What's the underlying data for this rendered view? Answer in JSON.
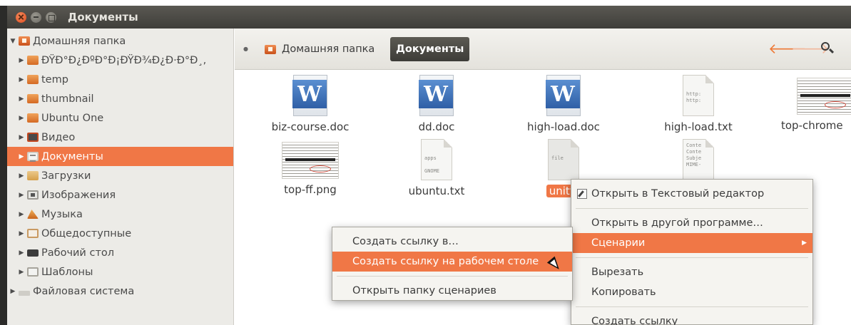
{
  "window": {
    "title": "Документы"
  },
  "sidebar": {
    "items": [
      {
        "label": "Домашняя папка",
        "icon": "home-folder-icon",
        "level": 0,
        "expanded": true
      },
      {
        "label": "ÐŸÐ°Ð¿ÐºÐ°Ð¡ÐŸÐ¾Ð¿Ð·Ð°Ð¸,",
        "icon": "folder-icon",
        "level": 1
      },
      {
        "label": "temp",
        "icon": "folder-icon",
        "level": 1
      },
      {
        "label": "thumbnail",
        "icon": "folder-icon",
        "level": 1
      },
      {
        "label": "Ubuntu One",
        "icon": "folder-icon",
        "level": 1
      },
      {
        "label": "Видео",
        "icon": "video-folder-icon",
        "level": 1
      },
      {
        "label": "Документы",
        "icon": "documents-folder-icon",
        "level": 1,
        "selected": true
      },
      {
        "label": "Загрузки",
        "icon": "downloads-folder-icon",
        "level": 1
      },
      {
        "label": "Изображения",
        "icon": "pictures-folder-icon",
        "level": 1
      },
      {
        "label": "Музыка",
        "icon": "music-folder-icon",
        "level": 1
      },
      {
        "label": "Общедоступные",
        "icon": "public-folder-icon",
        "level": 1
      },
      {
        "label": "Рабочий стол",
        "icon": "desktop-folder-icon",
        "level": 1
      },
      {
        "label": "Шаблоны",
        "icon": "templates-folder-icon",
        "level": 1
      },
      {
        "label": "Файловая система",
        "icon": "filesystem-icon",
        "level": 0
      }
    ]
  },
  "pathbar": {
    "home": "Домашняя папка",
    "current": "Документы"
  },
  "files": [
    {
      "name": "biz-course.doc",
      "type": "doc"
    },
    {
      "name": "dd.doc",
      "type": "doc"
    },
    {
      "name": "high-load.doc",
      "type": "doc"
    },
    {
      "name": "high-load.txt",
      "type": "txt",
      "preview": "http:\nhttp:"
    },
    {
      "name": "top-chrome",
      "type": "img"
    },
    {
      "name": "top-ff.png",
      "type": "img"
    },
    {
      "name": "ubuntu.txt",
      "type": "txt",
      "preview": "apps\n\nGNOME"
    },
    {
      "name": "unity.",
      "type": "txt",
      "preview": "file",
      "selected": true
    },
    {
      "name": "",
      "type": "txt",
      "preview": "Conte\nConte\nSubje\nMIME-"
    }
  ],
  "context_menu": {
    "items": [
      "Открыть в Текстовый редактор",
      "Открыть в другой программе…",
      "Сценарии",
      "Вырезать",
      "Копировать",
      "Создать ссылку"
    ]
  },
  "scripts_submenu": {
    "items": [
      "Создать ссылку в…",
      "Создать ссылку на рабочем столе",
      "Открыть папку сценариев"
    ]
  },
  "colors": {
    "accent": "#f07746",
    "titlebar": "#3f3e3a",
    "sidebar_bg": "#ecebe7"
  }
}
